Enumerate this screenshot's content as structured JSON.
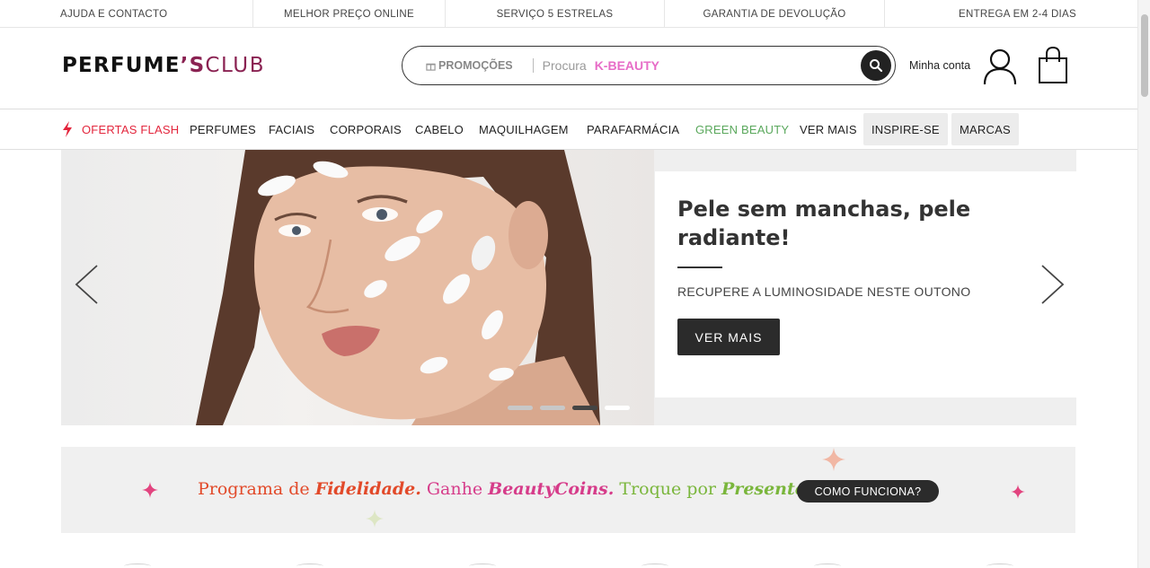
{
  "topbar": {
    "items": [
      "AJUDA E CONTACTO",
      "MELHOR PREÇO ONLINE",
      "SERVIÇO 5 ESTRELAS",
      "GARANTIA DE DEVOLUÇÃO",
      "ENTREGA EM 2-4 DIAS"
    ]
  },
  "header": {
    "logo_main": "PERFUME",
    "logo_apos": "’S",
    "logo_club": "CLUB",
    "promo_label": "PROMOÇÕES",
    "search_placeholder": "Procura",
    "search_suggestion": "K-BEAUTY",
    "account_label": "Minha conta"
  },
  "nav": {
    "items": [
      "OFERTAS FLASH",
      "PERFUMES",
      "FACIAIS",
      "CORPORAIS",
      "CABELO",
      "MAQUILHAGEM",
      "PARAFARMÁCIA",
      "GREEN BEAUTY",
      "VER MAIS",
      "INSPIRE-SE",
      "MARCAS"
    ]
  },
  "hero": {
    "title": "Pele sem manchas, pele radiante!",
    "subtitle": "RECUPERE A LUMINOSIDADE NESTE OUTONO",
    "cta": "VER MAIS",
    "slide_count": 4,
    "active_slide": 3
  },
  "loyalty": {
    "t1": "Programa de ",
    "em1": "Fidelidade.",
    "t2": " Ganhe ",
    "em2": "BeautyCoins.",
    "t3": " Troque por ",
    "em3": "Presentes.",
    "button": "COMO FUNCIONA?"
  },
  "colors": {
    "flash_red": "#e3263d",
    "green_beauty": "#5aa85c",
    "brand_plum": "#8a2252",
    "kbeauty_pink": "#e76cc7"
  }
}
